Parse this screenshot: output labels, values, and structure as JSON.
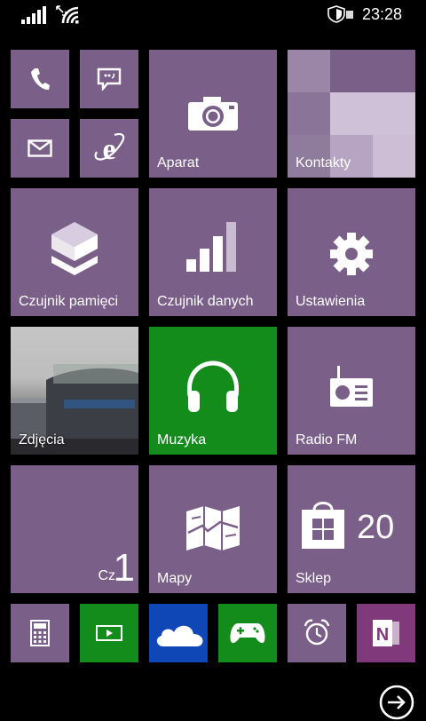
{
  "status_bar": {
    "time": "23:28",
    "icons": [
      "signal-strength-icon",
      "data-connection-icon",
      "wifi-icon",
      "battery-saver-shield-icon"
    ]
  },
  "tiles": {
    "phone": {
      "icon": "phone-icon"
    },
    "messaging": {
      "icon": "chat-bubble-icon"
    },
    "email": {
      "icon": "envelope-icon"
    },
    "browser": {
      "icon": "internet-explorer-icon"
    },
    "camera": {
      "label": "Aparat",
      "icon": "camera-icon"
    },
    "contacts": {
      "label": "Kontakty"
    },
    "storage": {
      "label": "Czujnik pamięci",
      "icon": "storage-cube-icon"
    },
    "data_sense": {
      "label": "Czujnik danych",
      "icon": "signal-bars-icon"
    },
    "settings": {
      "label": "Ustawienia",
      "icon": "gear-icon"
    },
    "photos": {
      "label": "Zdjęcia"
    },
    "music": {
      "label": "Muzyka",
      "icon": "headphones-icon"
    },
    "radio": {
      "label": "Radio FM",
      "icon": "radio-icon"
    },
    "calendar": {
      "day_name": "Cz",
      "day_number": "1"
    },
    "maps": {
      "label": "Mapy",
      "icon": "map-icon"
    },
    "store": {
      "label": "Sklep",
      "count": "20",
      "icon": "store-bag-icon"
    },
    "calculator": {
      "icon": "calculator-icon"
    },
    "video": {
      "icon": "video-play-icon"
    },
    "onedrive": {
      "icon": "cloud-icon"
    },
    "xbox_games": {
      "icon": "gamepad-icon"
    },
    "alarms": {
      "icon": "alarm-clock-icon"
    },
    "onenote": {
      "icon": "onenote-icon"
    }
  },
  "app_list": {
    "icon": "arrow-right-circle-icon"
  },
  "colors": {
    "accent": "#7a5f89",
    "music": "#138c1b",
    "video": "#138c1b",
    "onedrive": "#0f47b7",
    "xbox": "#138c1b",
    "onenote": "#80397b"
  }
}
